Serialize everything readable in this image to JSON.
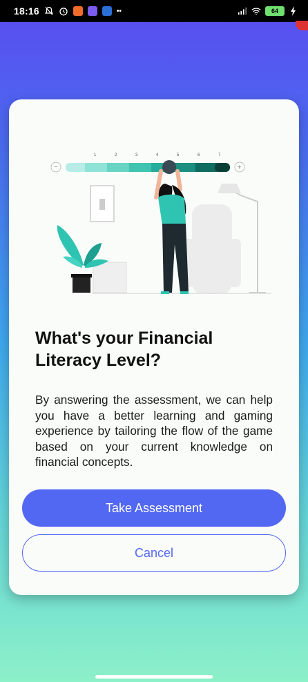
{
  "status_bar": {
    "time": "18:16",
    "battery": "64",
    "more": "••"
  },
  "illustration": {
    "scale_numbers": [
      "1",
      "2",
      "3",
      "4",
      "5",
      "6",
      "7"
    ],
    "minus": "−",
    "plus": "+"
  },
  "card": {
    "title": "What's your Financial Literacy Level?",
    "description": "By answering the assessment, we can help you have a better learning and gaming experience by tailoring the flow of the game based on your current knowledge on financial concepts.",
    "primary_label": "Take Assessment",
    "secondary_label": "Cancel"
  },
  "colors": {
    "accent": "#5267f2",
    "teal": "#2fc4b2",
    "card_bg": "#fafcf9"
  }
}
